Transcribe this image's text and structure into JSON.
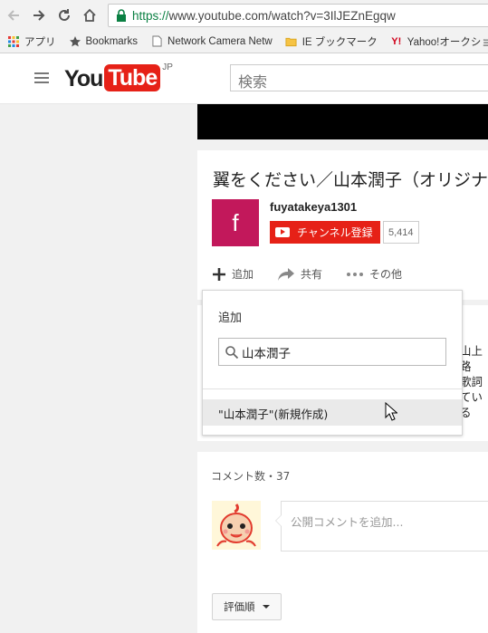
{
  "browser": {
    "url_secure": "https://",
    "url_rest": "www.youtube.com/watch?v=3IlJEZnEgqw",
    "bookmarks": [
      {
        "label": "アプリ",
        "icon": "apps-grid-icon"
      },
      {
        "label": "Bookmarks",
        "icon": "star-icon"
      },
      {
        "label": "Network Camera Netw",
        "icon": "page-icon"
      },
      {
        "label": "IE ブックマーク",
        "icon": "folder-icon"
      },
      {
        "label": "Yahoo!オークション",
        "icon": "yahoo-icon"
      }
    ]
  },
  "header": {
    "logo_you": "You",
    "logo_tube": "Tube",
    "logo_region": "JP",
    "search_placeholder": "検索"
  },
  "video": {
    "title": "翼をください／山本潤子（オリジナ",
    "channel_initial": "f",
    "channel_name": "fuyatakeya1301",
    "subscribe_label": "チャンネル登録",
    "subscriber_count": "5,414",
    "actions": {
      "add": "追加",
      "share": "共有",
      "more": "その他"
    }
  },
  "description_partial": [
    "山上路",
    "歌詞",
    "ている"
  ],
  "add_popup": {
    "title": "追加",
    "search_value": "山本潤子",
    "new_playlist_option": "\"山本潤子\"(新規作成)"
  },
  "comments": {
    "count_label": "コメント数・37",
    "input_placeholder": "公開コメントを追加...",
    "sort_label": "評価順"
  },
  "colors": {
    "youtube_red": "#e62117",
    "channel_avatar": "#c2185b",
    "secure_green": "#0b8043"
  }
}
